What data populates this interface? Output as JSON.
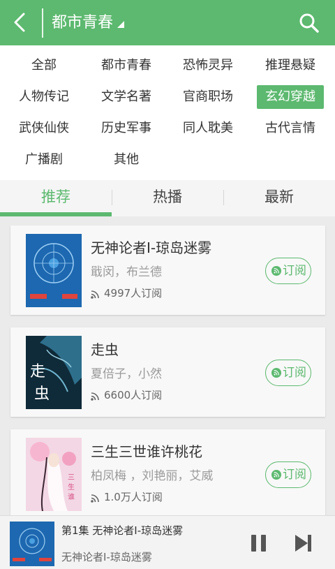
{
  "header": {
    "title": "都市青春"
  },
  "categories": [
    {
      "label": "全部",
      "active": false
    },
    {
      "label": "都市青春",
      "active": false
    },
    {
      "label": "恐怖灵异",
      "active": false
    },
    {
      "label": "推理悬疑",
      "active": false
    },
    {
      "label": "人物传记",
      "active": false
    },
    {
      "label": "文学名著",
      "active": false
    },
    {
      "label": "官商职场",
      "active": false
    },
    {
      "label": "玄幻穿越",
      "active": true
    },
    {
      "label": "武侠仙侠",
      "active": false
    },
    {
      "label": "历史军事",
      "active": false
    },
    {
      "label": "同人耽美",
      "active": false
    },
    {
      "label": "古代言情",
      "active": false
    },
    {
      "label": "广播剧",
      "active": false
    },
    {
      "label": "其他",
      "active": false
    }
  ],
  "tabs": [
    {
      "label": "推荐",
      "active": true
    },
    {
      "label": "热播",
      "active": false
    },
    {
      "label": "最新",
      "active": false
    }
  ],
  "books": [
    {
      "title": "无神论者Ⅰ-琼岛迷雾",
      "author": "戢闵，布兰德",
      "subscribers": "4997人订阅",
      "subscribe_label": "订阅"
    },
    {
      "title": "走虫",
      "author": "夏倍子，小然",
      "subscribers": "6600人订阅",
      "subscribe_label": "订阅"
    },
    {
      "title": "三生三世谁许桃花",
      "author": "柏凤梅 ，刘艳丽，艾威",
      "subscribers": "1.0万人订阅",
      "subscribe_label": "订阅"
    }
  ],
  "player": {
    "episode": "第1集  无神论者Ⅰ-琼岛迷雾",
    "album": "无神论者Ⅰ-琼岛迷雾"
  },
  "colors": {
    "accent": "#5cb96f",
    "background": "#ebebeb"
  }
}
